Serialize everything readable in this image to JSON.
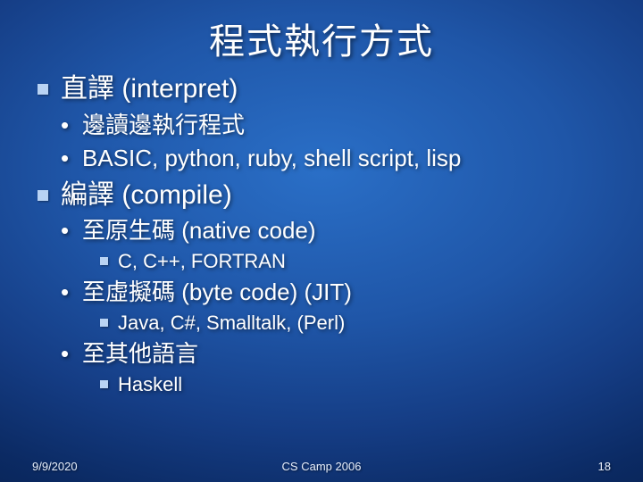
{
  "title": "程式執行方式",
  "items": [
    {
      "label": "直譯 (interpret)",
      "children": [
        {
          "label": "邊讀邊執行程式"
        },
        {
          "label": "BASIC, python, ruby, shell script, lisp"
        }
      ]
    },
    {
      "label": "編譯 (compile)",
      "children": [
        {
          "label": "至原生碼 (native code)",
          "children": [
            {
              "label": "C, C++, FORTRAN"
            }
          ]
        },
        {
          "label": "至虛擬碼 (byte code) (JIT)",
          "children": [
            {
              "label": "Java, C#, Smalltalk, (Perl)"
            }
          ]
        },
        {
          "label": "至其他語言",
          "children": [
            {
              "label": "Haskell"
            }
          ]
        }
      ]
    }
  ],
  "footer": {
    "date": "9/9/2020",
    "center": "CS Camp 2006",
    "page": "18"
  }
}
